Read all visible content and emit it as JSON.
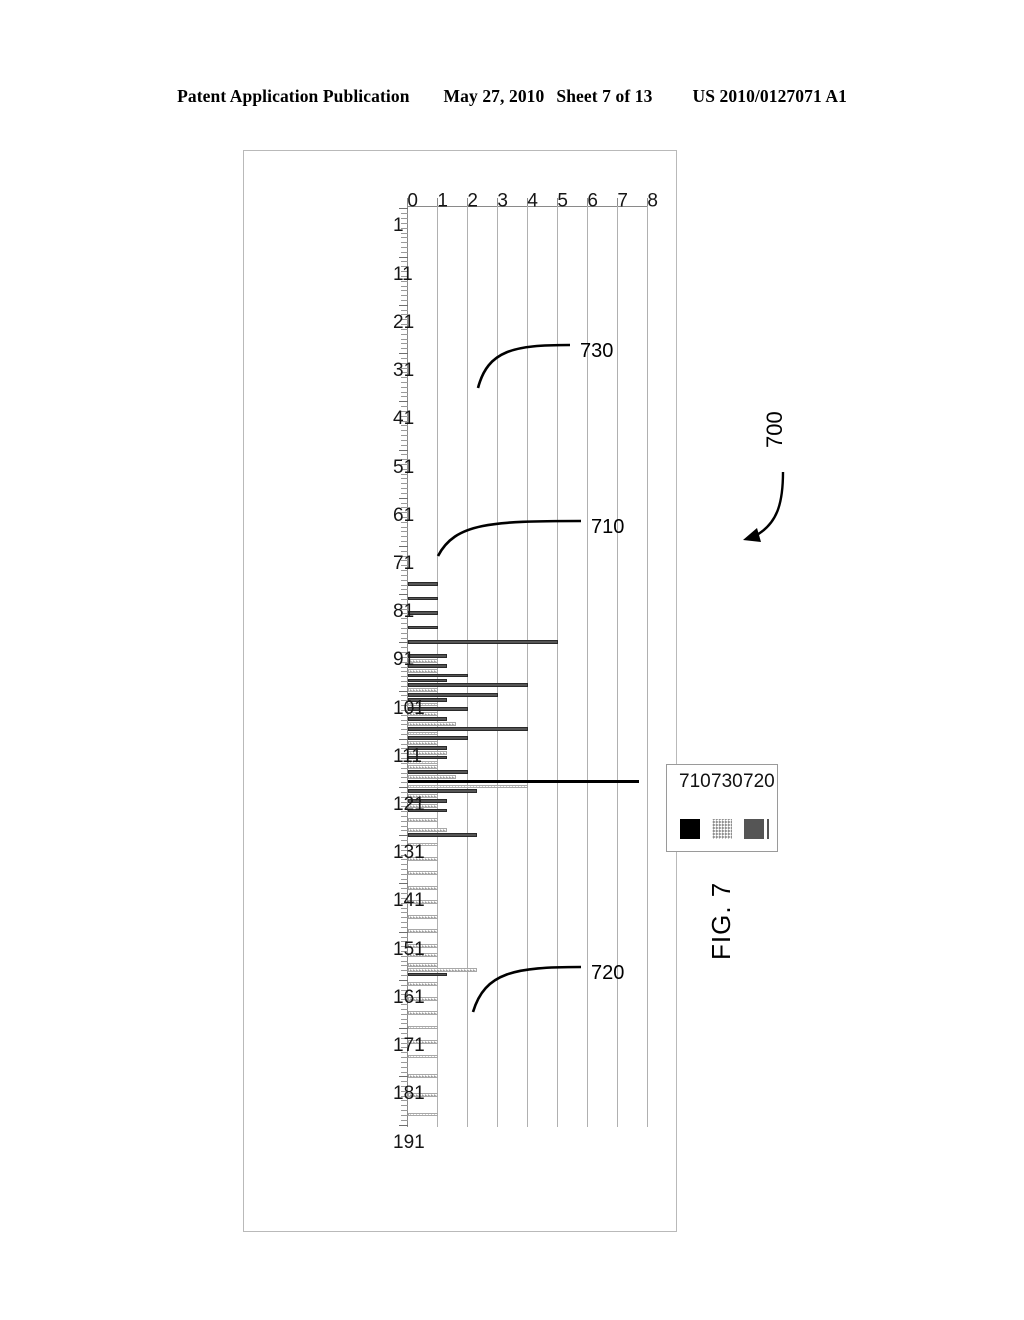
{
  "header": {
    "publication": "Patent Application Publication",
    "date": "May 27, 2010",
    "sheet": "Sheet 7 of 13",
    "pub_number": "US 2010/0127071 A1"
  },
  "figure": {
    "caption": "FIG. 7",
    "reference_numeral": "700",
    "callouts": [
      {
        "id": "callout-710",
        "label": "710"
      },
      {
        "id": "callout-720",
        "label": "720"
      },
      {
        "id": "callout-730",
        "label": "730"
      }
    ]
  },
  "legend": {
    "entries": [
      {
        "label": "720",
        "pattern": "dense-checker",
        "color": "#1c1c1c",
        "has_rule": true
      },
      {
        "label": "730",
        "pattern": "sparse-checker",
        "color": "#9c9c9c",
        "has_rule": false
      },
      {
        "label": "710",
        "pattern": "solid",
        "color": "#000000",
        "has_rule": false
      }
    ]
  },
  "chart_data": {
    "type": "bar",
    "title": "",
    "subtitle": "",
    "xlabel": "",
    "ylabel": "",
    "orientation": "rotated-90",
    "grid": true,
    "legend_position": "top-right",
    "xlim": [
      1,
      191
    ],
    "ylim": [
      0,
      8
    ],
    "ytick_labels": [
      "0",
      "1",
      "2",
      "3",
      "4",
      "5",
      "6",
      "7",
      "8"
    ],
    "ytick_values": [
      0,
      1,
      2,
      3,
      4,
      5,
      6,
      7,
      8
    ],
    "xtick_labels": [
      "1",
      "11",
      "21",
      "31",
      "41",
      "51",
      "61",
      "71",
      "81",
      "91",
      "101",
      "111",
      "121",
      "131",
      "141",
      "151",
      "161",
      "171",
      "181",
      "191"
    ],
    "xtick_values": [
      1,
      11,
      21,
      31,
      41,
      51,
      61,
      71,
      81,
      91,
      101,
      111,
      121,
      131,
      141,
      151,
      161,
      171,
      181,
      191
    ],
    "series": [
      {
        "name": "710",
        "pattern": "solid",
        "color": "#000000",
        "points": [
          {
            "x": 120,
            "y": 7.7
          }
        ]
      },
      {
        "name": "720",
        "pattern": "dense-checker",
        "color": "#1c1c1c",
        "points": [
          {
            "x": 79,
            "y": 1.0
          },
          {
            "x": 82,
            "y": 1.0
          },
          {
            "x": 85,
            "y": 1.0
          },
          {
            "x": 88,
            "y": 1.0
          },
          {
            "x": 91,
            "y": 5.0
          },
          {
            "x": 94,
            "y": 1.3
          },
          {
            "x": 96,
            "y": 1.3
          },
          {
            "x": 98,
            "y": 2.0
          },
          {
            "x": 99,
            "y": 1.3
          },
          {
            "x": 100,
            "y": 4.0
          },
          {
            "x": 102,
            "y": 3.0
          },
          {
            "x": 103,
            "y": 1.3
          },
          {
            "x": 105,
            "y": 2.0
          },
          {
            "x": 107,
            "y": 1.3
          },
          {
            "x": 109,
            "y": 4.0
          },
          {
            "x": 111,
            "y": 2.0
          },
          {
            "x": 113,
            "y": 1.3
          },
          {
            "x": 115,
            "y": 1.3
          },
          {
            "x": 118,
            "y": 2.0
          },
          {
            "x": 122,
            "y": 2.3
          },
          {
            "x": 124,
            "y": 1.3
          },
          {
            "x": 126,
            "y": 1.3
          },
          {
            "x": 131,
            "y": 2.3
          },
          {
            "x": 160,
            "y": 1.3
          }
        ]
      },
      {
        "name": "730",
        "pattern": "sparse-checker",
        "color": "#9c9c9c",
        "points": [
          {
            "x": 95,
            "y": 1.0
          },
          {
            "x": 97,
            "y": 1.0
          },
          {
            "x": 101,
            "y": 1.0
          },
          {
            "x": 104,
            "y": 1.0
          },
          {
            "x": 106,
            "y": 1.0
          },
          {
            "x": 108,
            "y": 1.6
          },
          {
            "x": 110,
            "y": 1.0
          },
          {
            "x": 112,
            "y": 1.0
          },
          {
            "x": 114,
            "y": 1.3
          },
          {
            "x": 116,
            "y": 1.0
          },
          {
            "x": 117,
            "y": 1.0
          },
          {
            "x": 119,
            "y": 1.6
          },
          {
            "x": 121,
            "y": 4.0
          },
          {
            "x": 123,
            "y": 1.0
          },
          {
            "x": 125,
            "y": 1.0
          },
          {
            "x": 128,
            "y": 1.0
          },
          {
            "x": 130,
            "y": 1.3
          },
          {
            "x": 133,
            "y": 1.0
          },
          {
            "x": 136,
            "y": 1.0
          },
          {
            "x": 139,
            "y": 1.0
          },
          {
            "x": 142,
            "y": 1.0
          },
          {
            "x": 145,
            "y": 1.0
          },
          {
            "x": 148,
            "y": 1.0
          },
          {
            "x": 151,
            "y": 1.0
          },
          {
            "x": 154,
            "y": 1.0
          },
          {
            "x": 156,
            "y": 1.0
          },
          {
            "x": 158,
            "y": 1.0
          },
          {
            "x": 159,
            "y": 2.3
          },
          {
            "x": 162,
            "y": 1.0
          },
          {
            "x": 165,
            "y": 1.0
          },
          {
            "x": 168,
            "y": 1.0
          },
          {
            "x": 171,
            "y": 1.0
          },
          {
            "x": 174,
            "y": 1.0
          },
          {
            "x": 177,
            "y": 1.0
          },
          {
            "x": 181,
            "y": 1.0
          },
          {
            "x": 185,
            "y": 1.0
          },
          {
            "x": 189,
            "y": 1.0
          }
        ]
      }
    ]
  }
}
